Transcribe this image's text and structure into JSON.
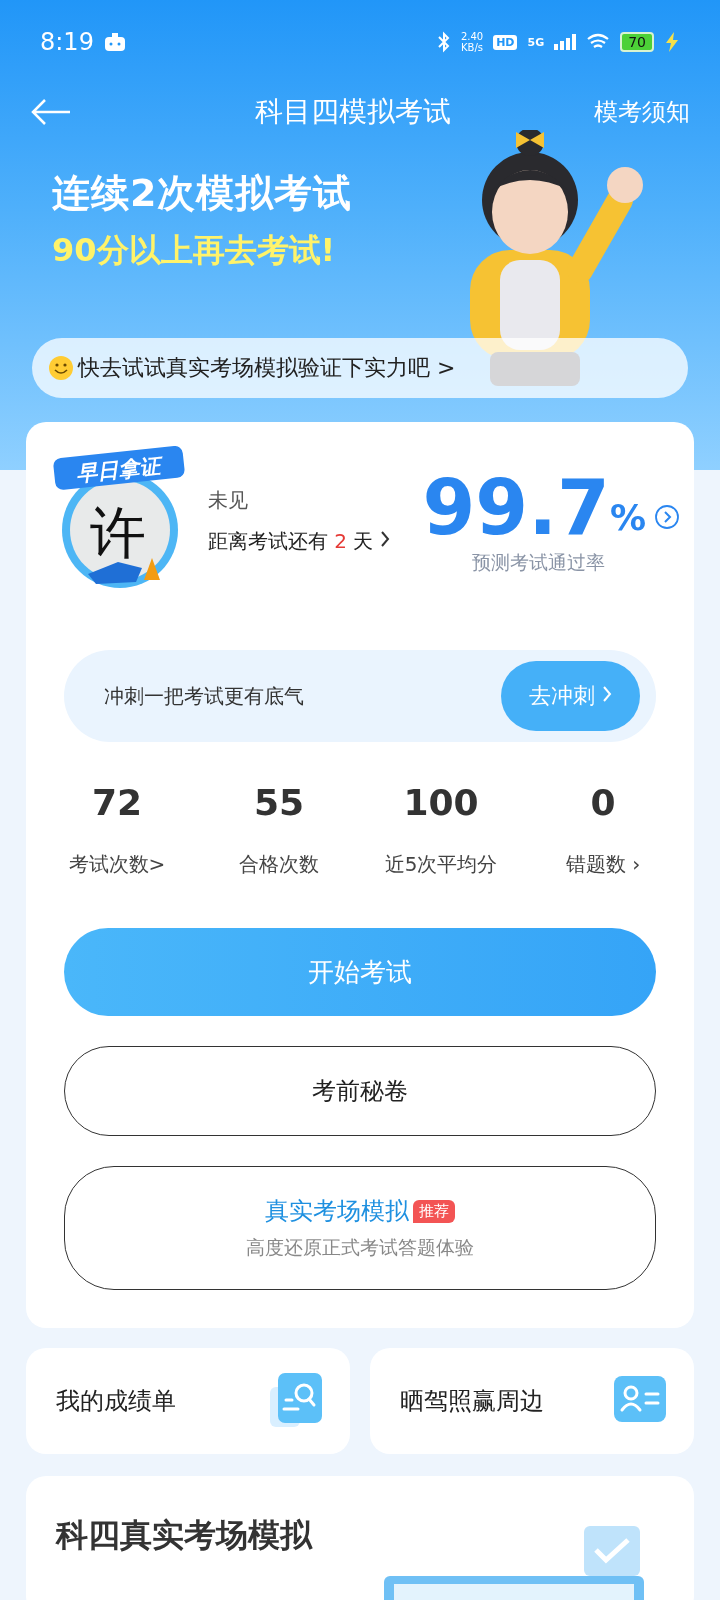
{
  "status_bar": {
    "time": "8:19",
    "net_speed": "2.40",
    "net_unit": "KB/s",
    "hd": "HD",
    "network": "5G",
    "battery": "70"
  },
  "header": {
    "title": "科目四模拟考试",
    "action": "模考须知"
  },
  "banner": {
    "line1": "连续2次模拟考试",
    "line2": "90分以上再去考试!",
    "tip": "快去试试真实考场模拟验证下实力吧 >"
  },
  "summary": {
    "badge": "早日拿证",
    "badge_char": "许",
    "name": "未见",
    "countdown_prefix": "距离考试还有",
    "countdown_days": "2",
    "countdown_suffix": "天",
    "pass_rate": "99.7",
    "pass_unit": "%",
    "pass_label": "预测考试通过率"
  },
  "sprint": {
    "text": "冲刺一把考试更有底气",
    "button": "去冲刺"
  },
  "stats": [
    {
      "value": "72",
      "label": "考试次数>"
    },
    {
      "value": "55",
      "label": "合格次数"
    },
    {
      "value": "100",
      "label": "近5次平均分"
    },
    {
      "value": "0",
      "label": "错题数 ›"
    }
  ],
  "buttons": [
    {
      "kind": "primary",
      "label": "开始考试"
    },
    {
      "kind": "outline",
      "label": "考前秘卷"
    },
    {
      "kind": "featured",
      "label": "真实考场模拟",
      "tag": "推荐",
      "subtitle": "高度还原正式考试答题体验"
    }
  ],
  "tiles": [
    {
      "kind": "search",
      "label": "我的成绩单"
    },
    {
      "kind": "person",
      "label": "晒驾照赢周边"
    }
  ],
  "section": {
    "title": "科四真实考场模拟"
  }
}
